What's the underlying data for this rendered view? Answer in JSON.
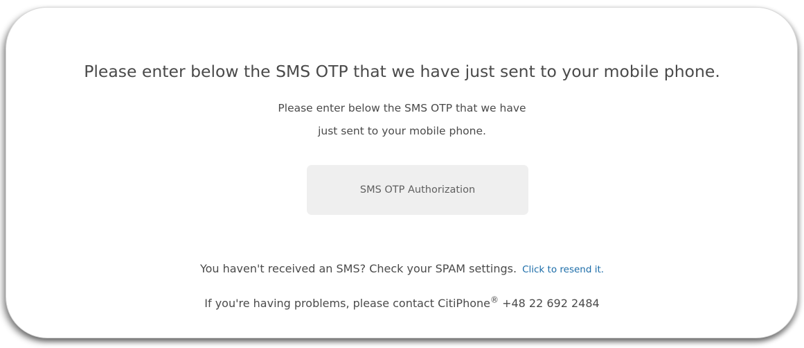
{
  "otp": {
    "heading": "Please enter below the SMS OTP that we have just sent to your mobile phone.",
    "subtext_line1": "Please enter below the SMS OTP that we have",
    "subtext_line2": "just sent to your mobile phone.",
    "authorization_button_label": "SMS OTP Authorization",
    "not_received_text": "You haven't received an SMS? Check your SPAM settings.",
    "resend_link_label": "Click to resend it.",
    "contact_text": "If you're having problems, please contact CitiPhone",
    "registered_mark": "®",
    "contact_phone": "+48 22 692 2484"
  },
  "colors": {
    "link": "#1b6ca8",
    "text": "#4a4a4a",
    "button_background": "#efefef"
  }
}
